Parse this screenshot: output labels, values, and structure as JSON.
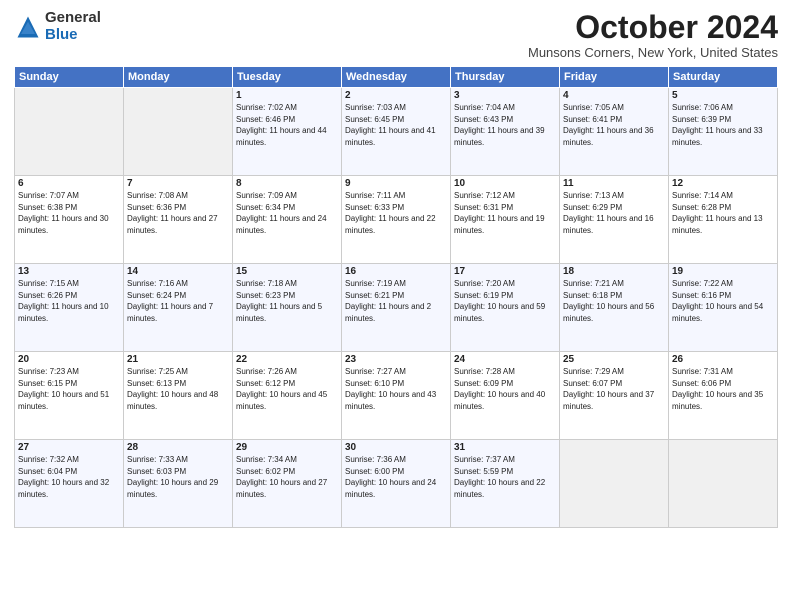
{
  "logo": {
    "general": "General",
    "blue": "Blue"
  },
  "title": "October 2024",
  "location": "Munsons Corners, New York, United States",
  "days_of_week": [
    "Sunday",
    "Monday",
    "Tuesday",
    "Wednesday",
    "Thursday",
    "Friday",
    "Saturday"
  ],
  "weeks": [
    [
      {
        "day": "",
        "sunrise": "",
        "sunset": "",
        "daylight": ""
      },
      {
        "day": "",
        "sunrise": "",
        "sunset": "",
        "daylight": ""
      },
      {
        "day": "1",
        "sunrise": "Sunrise: 7:02 AM",
        "sunset": "Sunset: 6:46 PM",
        "daylight": "Daylight: 11 hours and 44 minutes."
      },
      {
        "day": "2",
        "sunrise": "Sunrise: 7:03 AM",
        "sunset": "Sunset: 6:45 PM",
        "daylight": "Daylight: 11 hours and 41 minutes."
      },
      {
        "day": "3",
        "sunrise": "Sunrise: 7:04 AM",
        "sunset": "Sunset: 6:43 PM",
        "daylight": "Daylight: 11 hours and 39 minutes."
      },
      {
        "day": "4",
        "sunrise": "Sunrise: 7:05 AM",
        "sunset": "Sunset: 6:41 PM",
        "daylight": "Daylight: 11 hours and 36 minutes."
      },
      {
        "day": "5",
        "sunrise": "Sunrise: 7:06 AM",
        "sunset": "Sunset: 6:39 PM",
        "daylight": "Daylight: 11 hours and 33 minutes."
      }
    ],
    [
      {
        "day": "6",
        "sunrise": "Sunrise: 7:07 AM",
        "sunset": "Sunset: 6:38 PM",
        "daylight": "Daylight: 11 hours and 30 minutes."
      },
      {
        "day": "7",
        "sunrise": "Sunrise: 7:08 AM",
        "sunset": "Sunset: 6:36 PM",
        "daylight": "Daylight: 11 hours and 27 minutes."
      },
      {
        "day": "8",
        "sunrise": "Sunrise: 7:09 AM",
        "sunset": "Sunset: 6:34 PM",
        "daylight": "Daylight: 11 hours and 24 minutes."
      },
      {
        "day": "9",
        "sunrise": "Sunrise: 7:11 AM",
        "sunset": "Sunset: 6:33 PM",
        "daylight": "Daylight: 11 hours and 22 minutes."
      },
      {
        "day": "10",
        "sunrise": "Sunrise: 7:12 AM",
        "sunset": "Sunset: 6:31 PM",
        "daylight": "Daylight: 11 hours and 19 minutes."
      },
      {
        "day": "11",
        "sunrise": "Sunrise: 7:13 AM",
        "sunset": "Sunset: 6:29 PM",
        "daylight": "Daylight: 11 hours and 16 minutes."
      },
      {
        "day": "12",
        "sunrise": "Sunrise: 7:14 AM",
        "sunset": "Sunset: 6:28 PM",
        "daylight": "Daylight: 11 hours and 13 minutes."
      }
    ],
    [
      {
        "day": "13",
        "sunrise": "Sunrise: 7:15 AM",
        "sunset": "Sunset: 6:26 PM",
        "daylight": "Daylight: 11 hours and 10 minutes."
      },
      {
        "day": "14",
        "sunrise": "Sunrise: 7:16 AM",
        "sunset": "Sunset: 6:24 PM",
        "daylight": "Daylight: 11 hours and 7 minutes."
      },
      {
        "day": "15",
        "sunrise": "Sunrise: 7:18 AM",
        "sunset": "Sunset: 6:23 PM",
        "daylight": "Daylight: 11 hours and 5 minutes."
      },
      {
        "day": "16",
        "sunrise": "Sunrise: 7:19 AM",
        "sunset": "Sunset: 6:21 PM",
        "daylight": "Daylight: 11 hours and 2 minutes."
      },
      {
        "day": "17",
        "sunrise": "Sunrise: 7:20 AM",
        "sunset": "Sunset: 6:19 PM",
        "daylight": "Daylight: 10 hours and 59 minutes."
      },
      {
        "day": "18",
        "sunrise": "Sunrise: 7:21 AM",
        "sunset": "Sunset: 6:18 PM",
        "daylight": "Daylight: 10 hours and 56 minutes."
      },
      {
        "day": "19",
        "sunrise": "Sunrise: 7:22 AM",
        "sunset": "Sunset: 6:16 PM",
        "daylight": "Daylight: 10 hours and 54 minutes."
      }
    ],
    [
      {
        "day": "20",
        "sunrise": "Sunrise: 7:23 AM",
        "sunset": "Sunset: 6:15 PM",
        "daylight": "Daylight: 10 hours and 51 minutes."
      },
      {
        "day": "21",
        "sunrise": "Sunrise: 7:25 AM",
        "sunset": "Sunset: 6:13 PM",
        "daylight": "Daylight: 10 hours and 48 minutes."
      },
      {
        "day": "22",
        "sunrise": "Sunrise: 7:26 AM",
        "sunset": "Sunset: 6:12 PM",
        "daylight": "Daylight: 10 hours and 45 minutes."
      },
      {
        "day": "23",
        "sunrise": "Sunrise: 7:27 AM",
        "sunset": "Sunset: 6:10 PM",
        "daylight": "Daylight: 10 hours and 43 minutes."
      },
      {
        "day": "24",
        "sunrise": "Sunrise: 7:28 AM",
        "sunset": "Sunset: 6:09 PM",
        "daylight": "Daylight: 10 hours and 40 minutes."
      },
      {
        "day": "25",
        "sunrise": "Sunrise: 7:29 AM",
        "sunset": "Sunset: 6:07 PM",
        "daylight": "Daylight: 10 hours and 37 minutes."
      },
      {
        "day": "26",
        "sunrise": "Sunrise: 7:31 AM",
        "sunset": "Sunset: 6:06 PM",
        "daylight": "Daylight: 10 hours and 35 minutes."
      }
    ],
    [
      {
        "day": "27",
        "sunrise": "Sunrise: 7:32 AM",
        "sunset": "Sunset: 6:04 PM",
        "daylight": "Daylight: 10 hours and 32 minutes."
      },
      {
        "day": "28",
        "sunrise": "Sunrise: 7:33 AM",
        "sunset": "Sunset: 6:03 PM",
        "daylight": "Daylight: 10 hours and 29 minutes."
      },
      {
        "day": "29",
        "sunrise": "Sunrise: 7:34 AM",
        "sunset": "Sunset: 6:02 PM",
        "daylight": "Daylight: 10 hours and 27 minutes."
      },
      {
        "day": "30",
        "sunrise": "Sunrise: 7:36 AM",
        "sunset": "Sunset: 6:00 PM",
        "daylight": "Daylight: 10 hours and 24 minutes."
      },
      {
        "day": "31",
        "sunrise": "Sunrise: 7:37 AM",
        "sunset": "Sunset: 5:59 PM",
        "daylight": "Daylight: 10 hours and 22 minutes."
      },
      {
        "day": "",
        "sunrise": "",
        "sunset": "",
        "daylight": ""
      },
      {
        "day": "",
        "sunrise": "",
        "sunset": "",
        "daylight": ""
      }
    ]
  ]
}
